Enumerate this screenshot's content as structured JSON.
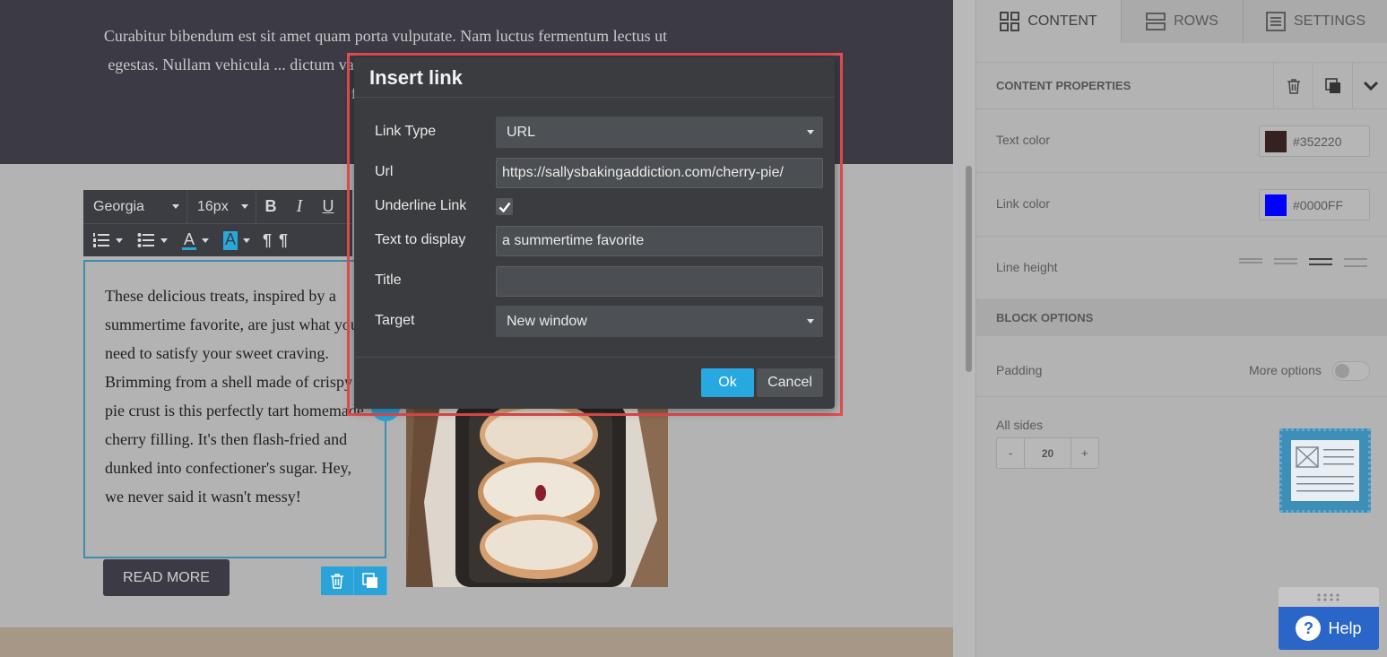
{
  "canvas": {
    "hero_text": "Curabitur bibendum est sit amet quam porta vulputate. Nam luctus fermentum lectus ut egestas. Nullam vehicula ... dictum varius maximus et, bibendu ... congue, dolor lacus fringilla ni",
    "body_text": "These delicious treats, inspired by a summertime favorite, are just what you need to satisfy your sweet craving. Brimming from a shell made of crispy pie crust is this perfectly tart homemade cherry filling. It's then flash-fried and dunked into confectioner's sugar. Hey, we never said it wasn't messy!",
    "read_more_label": "READ MORE"
  },
  "text_toolbar": {
    "font_family": "Georgia",
    "font_size": "16px",
    "bold": "B",
    "italic": "I",
    "underline": "U",
    "text_color_glyph": "A",
    "highlight_glyph": "A",
    "ltr_glyph": "¶",
    "rtl_glyph": "¶"
  },
  "panel": {
    "tabs": [
      {
        "label": "CONTENT",
        "active": true
      },
      {
        "label": "ROWS",
        "active": false
      },
      {
        "label": "SETTINGS",
        "active": false
      }
    ],
    "content_properties_title": "CONTENT PROPERTIES",
    "text_color": {
      "label": "Text color",
      "value": "#352220",
      "swatch": "#352220"
    },
    "link_color": {
      "label": "Link color",
      "value": "#0000FF",
      "swatch": "#0000ff"
    },
    "line_height_label": "Line height",
    "block_options_title": "BLOCK OPTIONS",
    "padding_label": "Padding",
    "more_options_label": "More options",
    "all_sides_label": "All sides",
    "padding_minus": "-",
    "padding_value": "20",
    "padding_plus": "+",
    "help_label": "Help"
  },
  "modal": {
    "title": "Insert link",
    "link_type": {
      "label": "Link Type",
      "value": "URL"
    },
    "url": {
      "label": "Url",
      "value": "https://sallysbakingaddiction.com/cherry-pie/"
    },
    "underline": {
      "label": "Underline Link",
      "checked": true
    },
    "text_to_display": {
      "label": "Text to display",
      "value": "a summertime favorite"
    },
    "title_field": {
      "label": "Title",
      "value": ""
    },
    "target": {
      "label": "Target",
      "value": "New window"
    },
    "ok_label": "Ok",
    "cancel_label": "Cancel"
  },
  "colors": {
    "accent": "#28a8e0",
    "highlight_border": "#e84c4f",
    "help_button": "#2a66c8"
  }
}
